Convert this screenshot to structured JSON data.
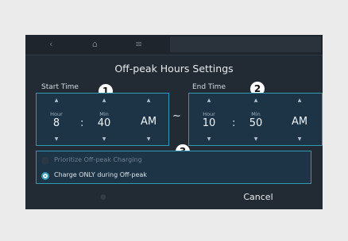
{
  "topbar": {
    "back_icon": "back-chevron-icon",
    "home_icon": "home-icon",
    "menu_icon": "menu-icon"
  },
  "dialog": {
    "title": "Off-peak Hours Settings"
  },
  "start_time": {
    "label": "Start Time",
    "hour_unit": "Hour",
    "hour_value": "8",
    "min_unit": "Min",
    "min_value": "40",
    "ampm": "AM",
    "colon": ":"
  },
  "end_time": {
    "label": "End Time",
    "hour_unit": "Hour",
    "hour_value": "10",
    "min_unit": "Min",
    "min_value": "50",
    "ampm": "AM",
    "colon": ":"
  },
  "range_separator": "~",
  "markers": [
    "1",
    "2",
    "3"
  ],
  "options": [
    {
      "label": "Prioritize Off-peak Charging",
      "selected": false
    },
    {
      "label": "Charge ONLY during Off-peak",
      "selected": true
    }
  ],
  "footer": {
    "cancel_label": "Cancel"
  },
  "colors": {
    "accent": "#2f9ab4",
    "background": "#222a33",
    "panel": "#1d3447"
  }
}
